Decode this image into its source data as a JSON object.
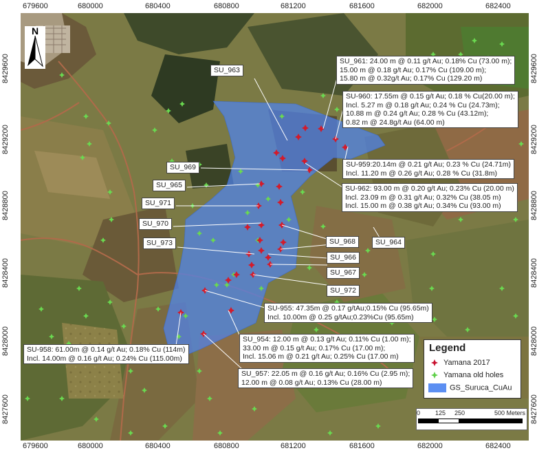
{
  "map": {
    "axes": {
      "x_ticks": [
        "679600",
        "680000",
        "680400",
        "680800",
        "681200",
        "681600",
        "682000",
        "682400"
      ],
      "y_ticks": [
        "8429600",
        "8429200",
        "8428800",
        "8428400",
        "8428000",
        "8427600"
      ]
    },
    "north_arrow": {
      "letter": "N",
      "icon": "north-arrow-icon"
    },
    "legend": {
      "title": "Legend",
      "items": [
        {
          "label": "Yamana 2017",
          "symbol": "red-cross-icon",
          "color": "#c8102e"
        },
        {
          "label": "Yamana old holes",
          "symbol": "green-cross-icon",
          "color": "#5fd04a"
        },
        {
          "label": "GS_Suruca_CuAu",
          "symbol": "blue-polygon-swatch",
          "color": "#5c8ff2"
        }
      ]
    },
    "scale_bar": {
      "ticks": [
        "0",
        "125",
        "250",
        "500 Meters"
      ]
    },
    "colors": {
      "target_polygon": "#4f84ee",
      "new_hole": "#d41a2a",
      "old_hole": "#6ad950"
    },
    "hole_labels": [
      {
        "id": "su963",
        "lines": [
          "SU_963"
        ]
      },
      {
        "id": "su961",
        "lines": [
          "SU_961: 24.00 m @ 0.11 g/t Au; 0.18% Cu (73.00 m);",
          "15.00 m @ 0.18 g/t Au; 0.17% Cu (109.00 m);",
          "15.80 m @ 0.32g/t Au; 0.17% Cu (129.20 m)"
        ]
      },
      {
        "id": "su960",
        "lines": [
          "SU-960: 17.55m @ 0.15 g/t Au; 0.18 % Cu(20.00 m);",
          "Incl. 5.27 m @ 0.18 g/t Au; 0.24 % Cu (24.73m);",
          "10.88 m @ 0.24 g/t Au; 0.28 % Cu (43.12m);",
          "0.82 m @ 24.8g/t Au (64.00 m)"
        ]
      },
      {
        "id": "su959",
        "lines": [
          "SU-959:20.14m @ 0.21 g/t Au; 0.23 % Cu (24.71m)",
          "Incl. 11.20 m @ 0.26 g/t Au; 0.28 % Cu (31.8m)"
        ]
      },
      {
        "id": "su969",
        "lines": [
          "SU_969"
        ]
      },
      {
        "id": "su965",
        "lines": [
          "SU_965"
        ]
      },
      {
        "id": "su962",
        "lines": [
          "SU-962: 93.00 m @ 0.20 g/t Au; 0.23% Cu (20.00 m)",
          "Incl. 23.09 m @ 0.31 g/t Au; 0.32% Cu (38.05 m)",
          "Incl. 15.00 m @ 0.38 g/t Au; 0.34% Cu (93.00 m)"
        ]
      },
      {
        "id": "su971",
        "lines": [
          "SU_971"
        ]
      },
      {
        "id": "su970",
        "lines": [
          "SU_970"
        ]
      },
      {
        "id": "su964",
        "lines": [
          "SU_964"
        ]
      },
      {
        "id": "su968",
        "lines": [
          "SU_968"
        ]
      },
      {
        "id": "su973",
        "lines": [
          "SU_973"
        ]
      },
      {
        "id": "su966",
        "lines": [
          "SU_966"
        ]
      },
      {
        "id": "su967",
        "lines": [
          "SU_967"
        ]
      },
      {
        "id": "su972",
        "lines": [
          "SU_972"
        ]
      },
      {
        "id": "su955",
        "lines": [
          "SU-955: 47.35m @ 0.17 g/tAu;0.15% Cu (95.65m)",
          "Incl. 10.00m @ 0.25 g/tAu;0.23%Cu (95.65m)"
        ]
      },
      {
        "id": "su954",
        "lines": [
          "SU_954: 12.00 m @ 0.13 g/t Au; 0.11% Cu (1.00 m);",
          "33.00 m @ 0.15 g/t Au; 0.17% Cu (17.00 m);",
          "Incl. 15.06 m @ 0.21 g/t Au; 0.25% Cu (17.00 m)"
        ]
      },
      {
        "id": "su958",
        "lines": [
          "SU-958: 61.00m @ 0.14 g/t Au; 0.18% Cu (114m)",
          "Incl. 14.00m @ 0.16 g/t Au; 0.24% Cu (115.00m)"
        ]
      },
      {
        "id": "su957",
        "lines": [
          "SU_957: 22.05 m @ 0.16 g/t Au; 0.16% Cu (2.95 m);",
          "12.00 m @ 0.08 g/t Au; 0.13% Cu (28.00 m)"
        ]
      }
    ]
  }
}
